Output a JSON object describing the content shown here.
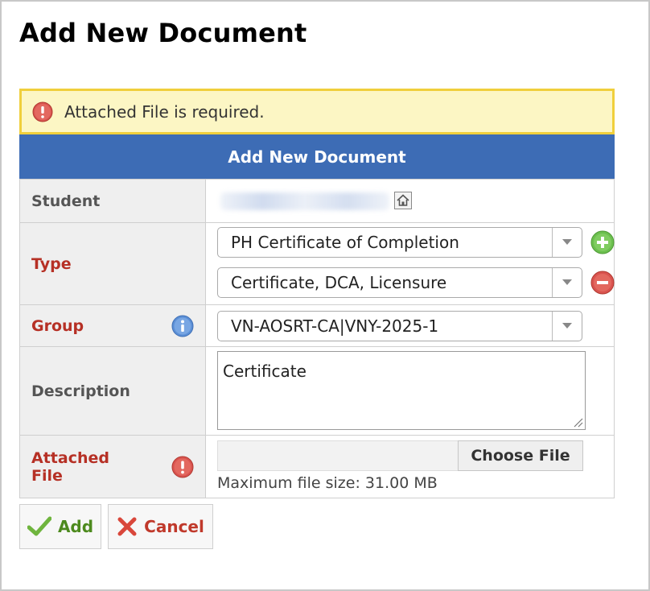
{
  "page": {
    "title": "Add New Document"
  },
  "alert": {
    "message": "Attached File is required.",
    "icon": "error-icon"
  },
  "form": {
    "header": "Add New Document",
    "student": {
      "label": "Student",
      "icon": "home-icon"
    },
    "type": {
      "label": "Type",
      "selects": [
        {
          "value": "PH Certificate of Completion"
        },
        {
          "value": "Certificate, DCA, Licensure"
        }
      ],
      "add_icon": "plus-circle-icon",
      "remove_icon": "minus-circle-icon"
    },
    "group": {
      "label": "Group",
      "value": "VN-AOSRT-CA|VNY-2025-1",
      "icon": "info-icon"
    },
    "description": {
      "label": "Description",
      "value": "Certificate"
    },
    "attached_file": {
      "label_line1": "Attached",
      "label_line2": "File",
      "button": "Choose File",
      "hint": "Maximum file size: 31.00 MB",
      "icon": "error-icon"
    }
  },
  "actions": {
    "add": "Add",
    "cancel": "Cancel"
  },
  "colors": {
    "header_blue": "#3d6cb5",
    "required_red": "#b63025",
    "alert_bg": "#fcf6c4",
    "alert_border": "#f0cf3c",
    "add_green": "#4d8a1e",
    "cancel_red": "#c0392b"
  }
}
